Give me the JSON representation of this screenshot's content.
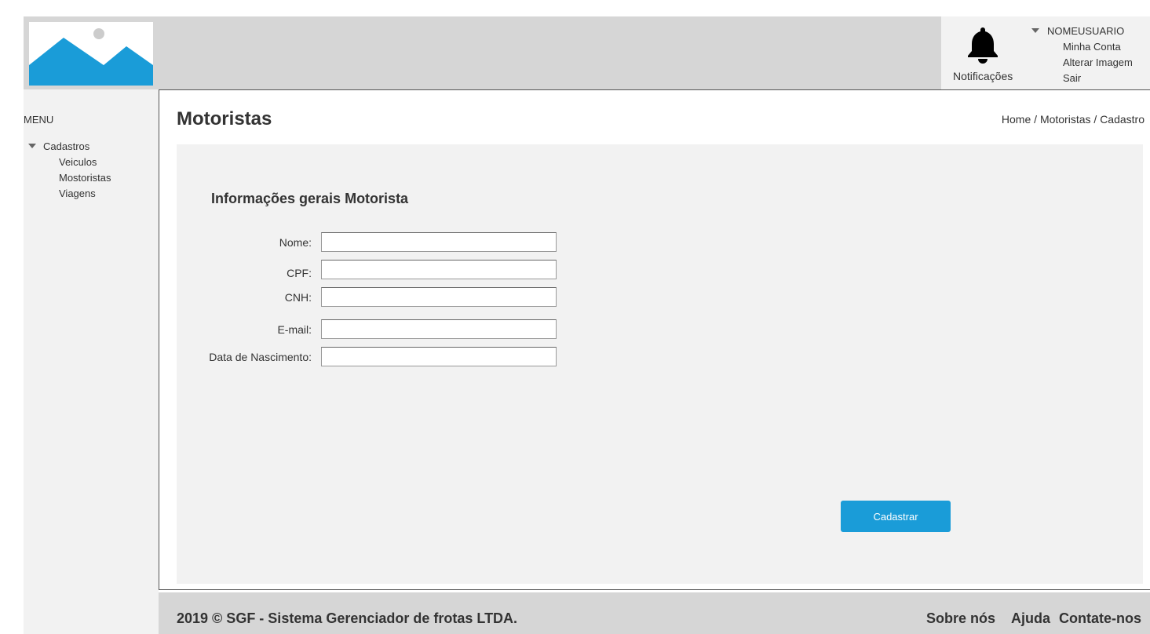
{
  "header": {
    "logo_icon": "image-placeholder-icon",
    "notifications": {
      "icon": "bell-icon",
      "label": "Notificações"
    },
    "user": {
      "name": "NOMEUSUARIO",
      "menu": [
        "Minha Conta",
        "Alterar Imagem",
        "Sair"
      ]
    }
  },
  "sidebar": {
    "title": "MENU",
    "group": {
      "label": "Cadastros",
      "items": [
        "Veiculos",
        "Mostoristas",
        "Viagens"
      ]
    }
  },
  "page": {
    "title": "Motoristas",
    "breadcrumb": [
      "Home",
      "Motoristas",
      "Cadastro"
    ],
    "breadcrumb_sep": " / "
  },
  "form": {
    "section_title": "Informações gerais Motorista",
    "fields": [
      {
        "label": "Nome:",
        "value": ""
      },
      {
        "label": "CPF:",
        "value": ""
      },
      {
        "label": "CNH:",
        "value": ""
      },
      {
        "label": "E-mail:",
        "value": ""
      },
      {
        "label": "Data de Nascimento:",
        "value": ""
      }
    ],
    "submit_label": "Cadastrar"
  },
  "footer": {
    "copyright": "2019 © SGF - Sistema Gerenciador de frotas LTDA.",
    "links": [
      "Sobre nós",
      "Ajuda",
      "Contate-nos"
    ]
  },
  "colors": {
    "accent": "#1a9cd8",
    "header_bg": "#d6d6d6",
    "panel_bg": "#f2f2f2"
  }
}
